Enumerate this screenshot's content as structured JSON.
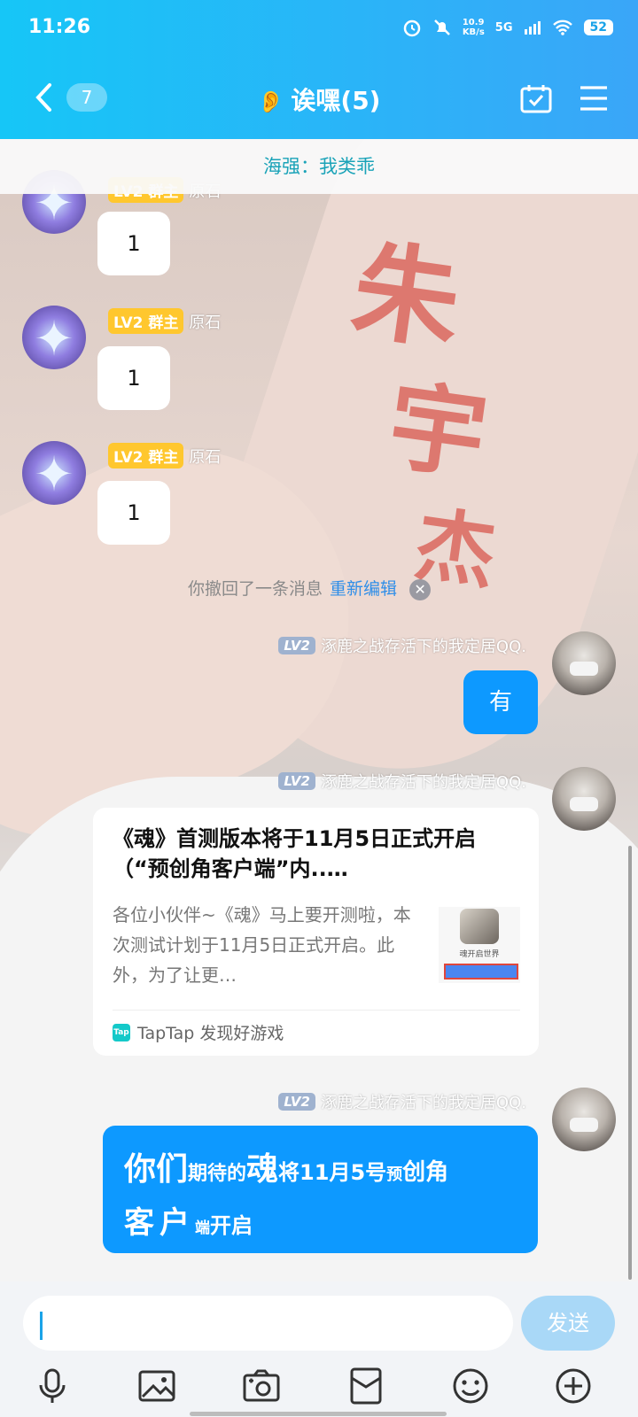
{
  "status_bar": {
    "time": "11:26",
    "net_speed": "10.9\nKB/s",
    "network": "5G",
    "battery": "52"
  },
  "header": {
    "unread_count": "7",
    "title": "诶嘿(5)"
  },
  "pinned": {
    "text": "海强：我类乖"
  },
  "messages": [
    {
      "sender": "原石",
      "badge": "LV2 群主",
      "text": "1"
    },
    {
      "sender": "原石",
      "badge": "LV2 群主",
      "text": "1"
    },
    {
      "sender": "原石",
      "badge": "LV2 群主",
      "text": "1"
    }
  ],
  "recall": {
    "text": "你撤回了一条消息",
    "action": "重新编辑"
  },
  "my_messages": {
    "badge": "LV2",
    "name": "涿鹿之战存活下的我定居QQ.",
    "reply_text": "有",
    "card": {
      "title": "《魂》首测版本将于11月5日正式开启（“预创角客户端”内..…",
      "desc": "各位小伙伴~《魂》马上要开测啦，本次测试计划于11月5日正式开启。此外，为了让更…",
      "thumb_caption": "魂开启世界",
      "source": "TapTap 发现好游戏",
      "source_icon": "Tap"
    },
    "rich_text": {
      "p1": "你们",
      "p2": "期待的",
      "p3": "魂",
      "p4": "将11月5号",
      "p5": "预",
      "p6": "创角",
      "p7": "客户",
      "p8": "端",
      "p9": "开启"
    }
  },
  "input": {
    "placeholder": "",
    "send_label": "发送"
  },
  "toolbar_icons": [
    "microphone-icon",
    "image-icon",
    "camera-icon",
    "red-packet-icon",
    "emoji-icon",
    "plus-icon"
  ],
  "colors": {
    "header": "#16c6f7",
    "bubble_blue": "#0d99ff",
    "owner_badge": "#ffc72e",
    "link": "#2f8ee8"
  }
}
